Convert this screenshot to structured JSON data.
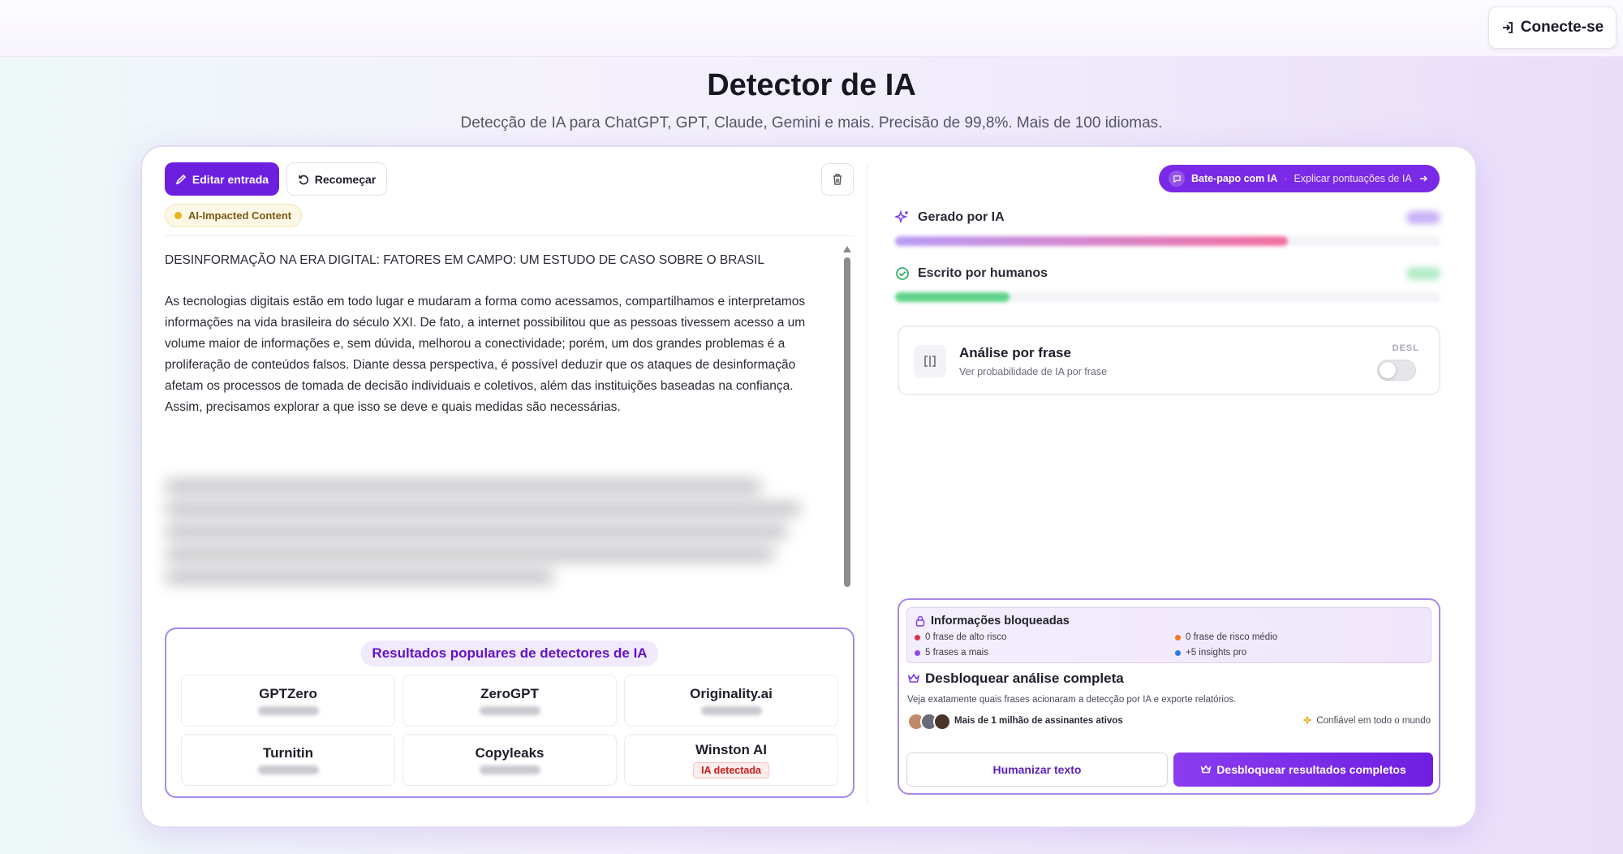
{
  "header": {
    "login_label": "Conecte-se"
  },
  "page": {
    "title": "Detector de IA",
    "subtitle": "Detecção de IA para ChatGPT, GPT, Claude, Gemini e mais. Precisão de 99,8%. Mais de 100 idiomas."
  },
  "toolbar": {
    "edit_label": "Editar entrada",
    "restart_label": "Recomeçar",
    "badge_label": "AI-Impacted Content"
  },
  "document": {
    "title": "DESINFORMAÇÃO NA ERA DIGITAL: FATORES EM CAMPO: UM ESTUDO DE CASO SOBRE O BRASIL",
    "paragraph": "As tecnologias digitais estão em todo lugar e mudaram a forma como acessamos, compartilhamos e interpretamos informações na vida brasileira do século XXI. De fato, a internet possibilitou que as pessoas tivessem acesso a um volume maior de informações e, sem dúvida, melhorou a conectividade; porém, um dos grandes problemas é a proliferação de conteúdos falsos. Diante dessa perspectiva, é possível deduzir que os ataques de desinformação afetam os processos de tomada de decisão individuais e coletivos, além das instituições baseadas na confiança. Assim, precisamos explorar a que isso se deve e quais medidas são necessárias."
  },
  "detectors": {
    "title": "Resultados populares de detectores de IA",
    "items": [
      {
        "name": "GPTZero"
      },
      {
        "name": "ZeroGPT"
      },
      {
        "name": "Originality.ai"
      },
      {
        "name": "Turnitin"
      },
      {
        "name": "Copyleaks"
      },
      {
        "name": "Winston AI",
        "flag": "IA detectada"
      }
    ]
  },
  "chat": {
    "label": "Bate-papo com IA",
    "separator": "·",
    "sublabel": "Explicar pontuações de IA"
  },
  "metrics": {
    "ai": {
      "label": "Gerado por IA",
      "color_start": "#b89cf5",
      "color_end": "#f36f9f"
    },
    "human": {
      "label": "Escrito por humanos",
      "color": "#5fd38a"
    }
  },
  "sentence_analysis": {
    "title": "Análise por frase",
    "subtitle": "Ver probabilidade de IA por frase",
    "state": "DESL"
  },
  "locked": {
    "title": "Informações bloqueadas",
    "items": [
      {
        "text": "0 frase de alto risco",
        "color": "#e0304a"
      },
      {
        "text": "0 frase de risco médio",
        "color": "#f07a1e"
      },
      {
        "text": "5 frases a mais",
        "color": "#8a4be8"
      },
      {
        "text": "+5 insights pro",
        "color": "#2f7ae5"
      }
    ]
  },
  "unlock": {
    "title": "Desbloquear análise completa",
    "description": "Veja exatamente quais frases acionaram a detecção por IA e exporte relatórios.",
    "subscribers": "Mais de 1 milhão de assinantes ativos",
    "trusted": "Confiável em todo o mundo",
    "humanize_label": "Humanizar texto",
    "unlock_label": "Desbloquear resultados completos"
  }
}
